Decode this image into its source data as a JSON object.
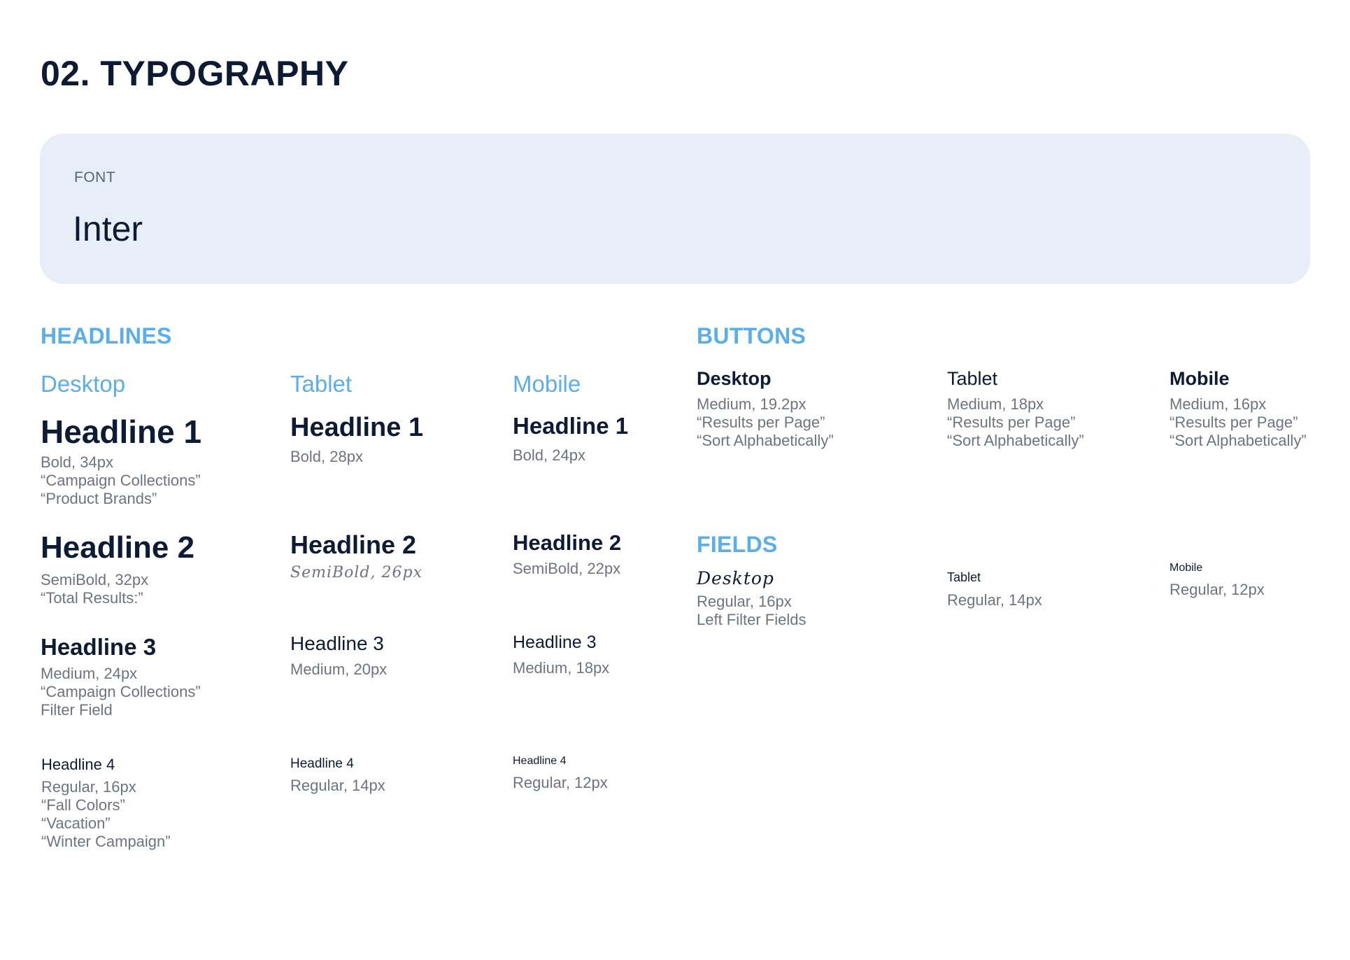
{
  "title": "02. TYPOGRAPHY",
  "font_card": {
    "label": "FONT",
    "name": "Inter"
  },
  "headlines": {
    "section_title": "HEADLINES",
    "columns": {
      "desktop": {
        "label": "Desktop",
        "h1": {
          "name": "Headline 1",
          "spec": "Bold, 34px",
          "examples": [
            "“Campaign Collections”",
            "“Product Brands”"
          ]
        },
        "h2": {
          "name": "Headline 2",
          "spec": "SemiBold, 32px",
          "examples": [
            "“Total Results:”"
          ]
        },
        "h3": {
          "name": "Headline 3",
          "spec": "Medium, 24px",
          "examples": [
            "“Campaign Collections”",
            "Filter Field"
          ]
        },
        "h4": {
          "name": "Headline 4",
          "spec": "Regular, 16px",
          "examples": [
            "“Fall Colors”",
            "“Vacation”",
            "“Winter Campaign”"
          ]
        }
      },
      "tablet": {
        "label": "Tablet",
        "h1": {
          "name": "Headline 1",
          "spec": "Bold, 28px"
        },
        "h2": {
          "name": "Headline 2",
          "spec": "SemiBold, 26px"
        },
        "h3": {
          "name": "Headline 3",
          "spec": "Medium, 20px"
        },
        "h4": {
          "name": "Headline 4",
          "spec": "Regular, 14px"
        }
      },
      "mobile": {
        "label": "Mobile",
        "h1": {
          "name": "Headline 1",
          "spec": "Bold, 24px"
        },
        "h2": {
          "name": "Headline 2",
          "spec": "SemiBold, 22px"
        },
        "h3": {
          "name": "Headline 3",
          "spec": "Medium, 18px"
        },
        "h4": {
          "name": "Headline 4",
          "spec": "Regular, 12px"
        }
      }
    }
  },
  "buttons": {
    "section_title": "BUTTONS",
    "desktop": {
      "label": "Desktop",
      "spec": "Medium, 19.2px",
      "examples": [
        "“Results per Page”",
        "“Sort Alphabetically”"
      ]
    },
    "tablet": {
      "label": "Tablet",
      "spec": "Medium, 18px",
      "examples": [
        "“Results per Page”",
        "“Sort Alphabetically”"
      ]
    },
    "mobile": {
      "label": "Mobile",
      "spec": "Medium, 16px",
      "examples": [
        "“Results per Page”",
        "“Sort Alphabetically”"
      ]
    }
  },
  "fields": {
    "section_title": "FIELDS",
    "desktop": {
      "label": "Desktop",
      "spec": "Regular, 16px",
      "examples": [
        "Left Filter Fields"
      ]
    },
    "tablet": {
      "label": "Tablet",
      "spec": "Regular, 14px"
    },
    "mobile": {
      "label": "Mobile",
      "spec": "Regular, 12px"
    }
  }
}
